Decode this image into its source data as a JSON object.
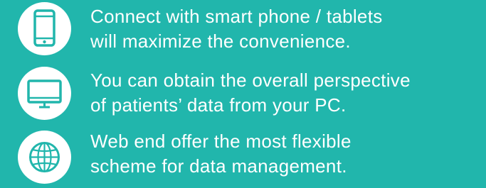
{
  "background_color": "#21b6ac",
  "icon_color": "#21b6ac",
  "features": [
    {
      "icon": "smartphone-icon",
      "line1": "Connect with smart phone / tablets",
      "line2": "will maximize the convenience."
    },
    {
      "icon": "monitor-icon",
      "line1": "You can obtain the overall perspective",
      "line2": "of patients’ data from your PC."
    },
    {
      "icon": "globe-icon",
      "line1": "Web end offer the most flexible",
      "line2": "scheme for data management."
    }
  ]
}
